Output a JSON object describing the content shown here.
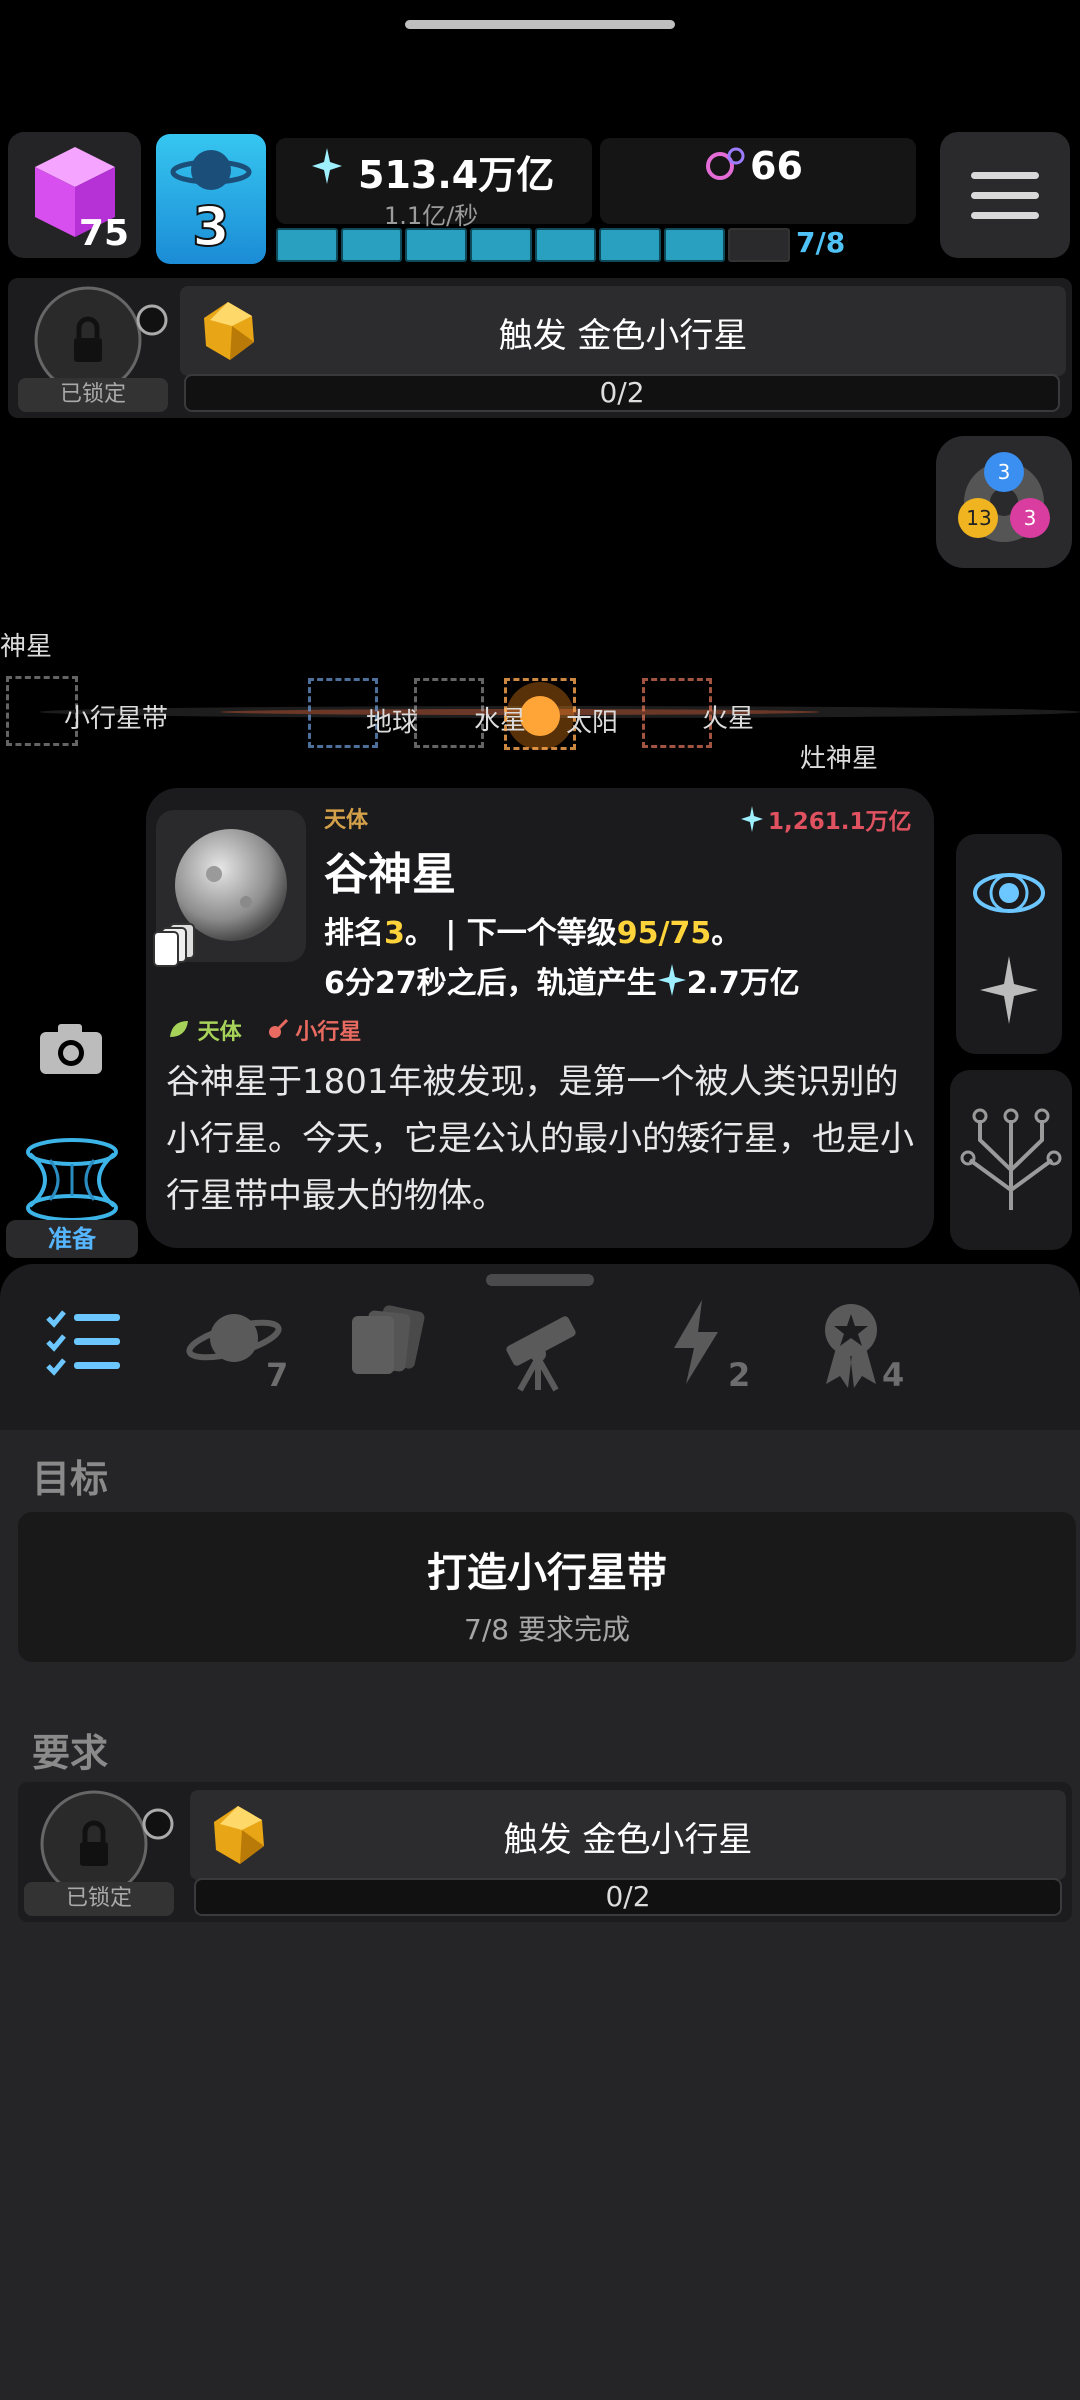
{
  "hud": {
    "cube_count": "75",
    "planet_level": "3",
    "stardust_value": "513.4万亿",
    "stardust_rate": "1.1亿/秒",
    "orbit_value": "66",
    "progress_label": "7/8",
    "progress_fraction": 0.875
  },
  "top_requirement": {
    "locked_label": "已锁定",
    "label": "触发 金色小行星",
    "progress": "0/2"
  },
  "map": {
    "labels": {
      "ceres_edge": "神星",
      "asteroid_belt": "小行星带",
      "earth": "地球",
      "mercury": "水星",
      "sun": "太阳",
      "mars": "火星",
      "vesta": "灶神星"
    },
    "gem_badges": [
      "3",
      "13",
      "3"
    ]
  },
  "card": {
    "type_tag": "天体",
    "value": "1,261.1万亿",
    "name": "谷神星",
    "rank_prefix": "排名",
    "rank_value": "3",
    "rank_sep": "。 | 下一个等级",
    "next_level": "95/75",
    "rank_end": "。",
    "orbit_line_prefix": "6分27秒之后，轨道产生",
    "orbit_line_value": "2.7万亿",
    "badge_body": "天体",
    "badge_asteroid": "小行星",
    "description": "谷神星于1801年被发现，是第一个被人类识别的小行星。今天，它是公认的最小的矮行星，也是小行星带中最大的物体。"
  },
  "left_tools": {
    "ready_label": "准备"
  },
  "tabs": {
    "planets_count": "7",
    "energy_count": "2",
    "awards_count": "4"
  },
  "goal": {
    "section_title": "目标",
    "title": "打造小行星带",
    "subtitle": "7/8 要求完成"
  },
  "requirements": {
    "section_title": "要求",
    "locked_label": "已锁定",
    "label": "触发 金色小行星",
    "progress": "0/2"
  },
  "colors": {
    "accent_blue": "#2aa0c0",
    "highlight_yellow": "#ffd43b",
    "value_red": "#e05260",
    "tab_active": "#6cc6ff"
  }
}
